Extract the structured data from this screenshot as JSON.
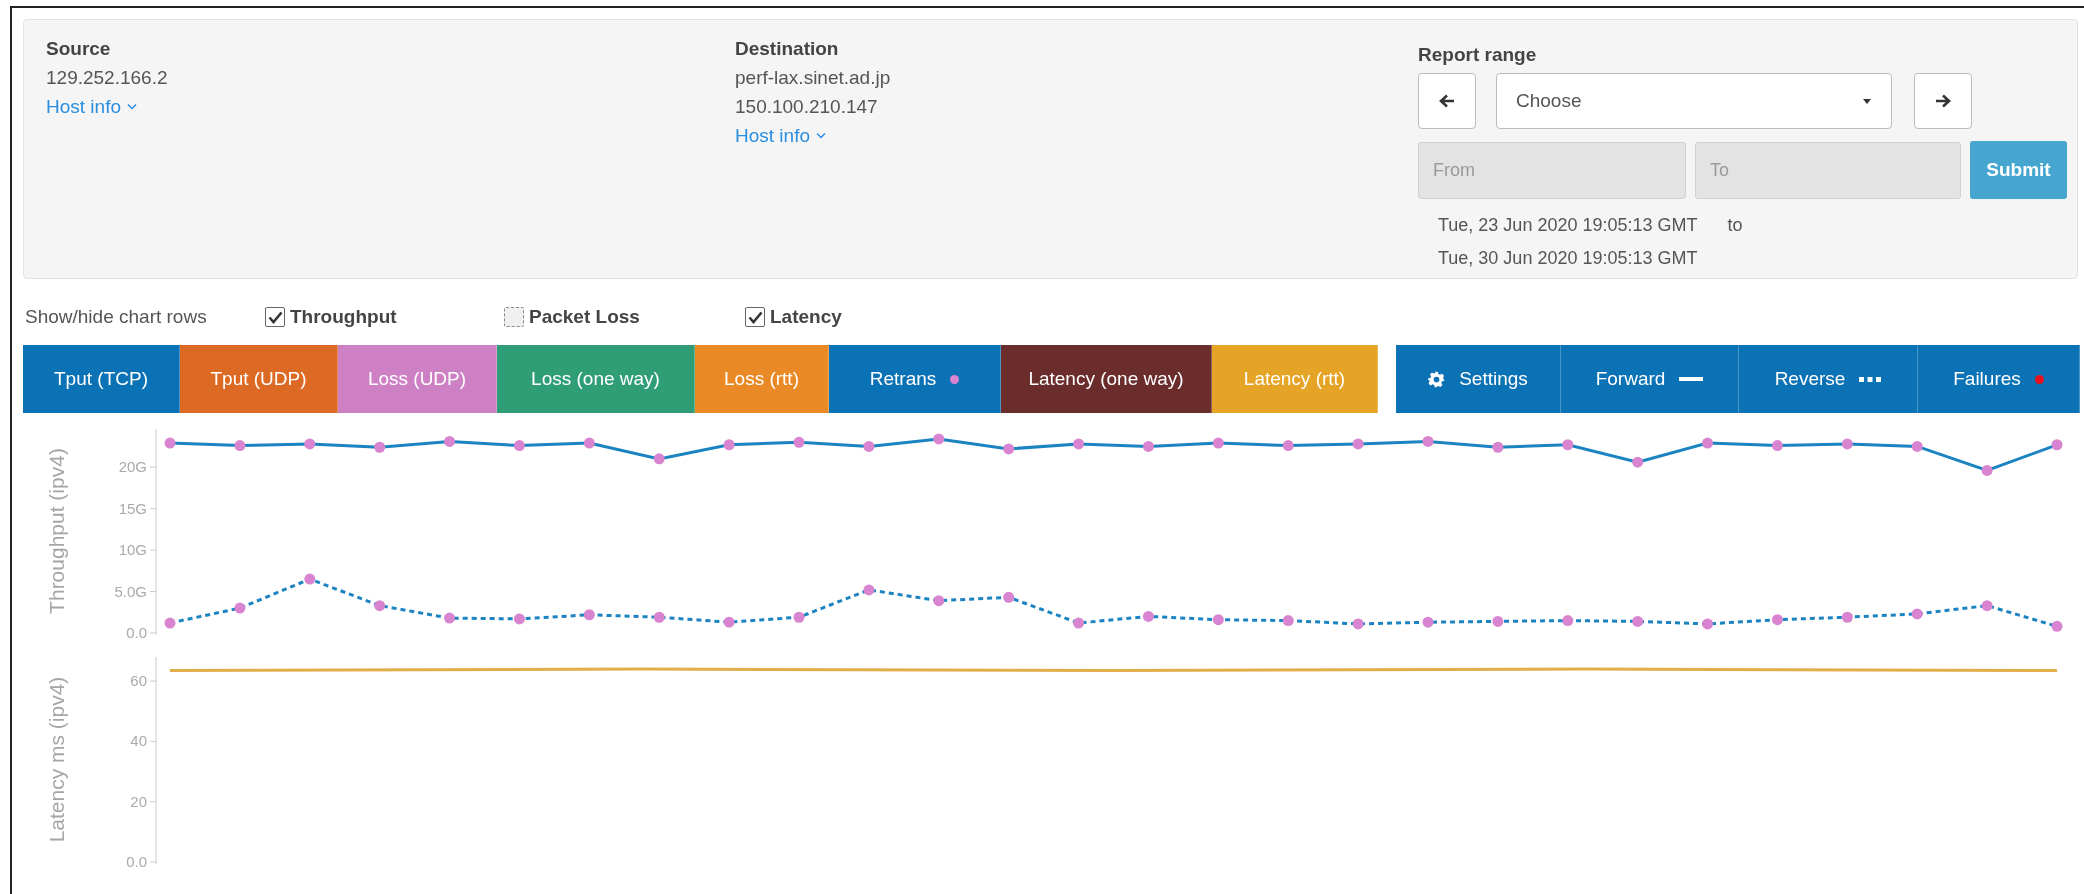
{
  "source": {
    "heading": "Source",
    "lines": [
      "129.252.166.2"
    ],
    "link": "Host info"
  },
  "destination": {
    "heading": "Destination",
    "lines": [
      "perf-lax.sinet.ad.jp",
      "150.100.210.147"
    ],
    "link": "Host info"
  },
  "report_range": {
    "heading": "Report range",
    "select": "Choose",
    "from_placeholder": "From",
    "to_placeholder": "To",
    "submit": "Submit",
    "start": "Tue, 23 Jun 2020 19:05:13 GMT",
    "joiner": "to",
    "end": "Tue, 30 Jun 2020 19:05:13 GMT"
  },
  "chart_rows": {
    "label": "Show/hide chart rows",
    "options": [
      {
        "label": "Throughput",
        "checked": true
      },
      {
        "label": "Packet Loss",
        "checked": false
      },
      {
        "label": "Latency",
        "checked": true
      }
    ]
  },
  "legend": [
    {
      "label": "Tput (TCP)",
      "color": "#0b72b5"
    },
    {
      "label": "Tput (UDP)",
      "color": "#dd6a24"
    },
    {
      "label": "Loss (UDP)",
      "color": "#cd80c4"
    },
    {
      "label": "Loss (one way)",
      "color": "#2f9e76"
    },
    {
      "label": "Loss (rtt)",
      "color": "#ea8a27"
    },
    {
      "label": "Retrans",
      "color": "#0b72b5",
      "marker": {
        "kind": "dot",
        "color": "#d884d0"
      }
    },
    {
      "label": "Latency (one way)",
      "color": "#6a2d2c"
    },
    {
      "label": "Latency (rtt)",
      "color": "#e5a425"
    }
  ],
  "controls": [
    {
      "label": "Settings",
      "marker": {
        "kind": "gear"
      }
    },
    {
      "label": "Forward",
      "marker": {
        "kind": "line"
      }
    },
    {
      "label": "Reverse",
      "marker": {
        "kind": "dots"
      }
    },
    {
      "label": "Failures",
      "marker": {
        "kind": "dot",
        "color": "#e8101a"
      }
    }
  ],
  "charts": [
    {
      "chart_data": {
        "type": "line",
        "ylabel": "Throughput (ipv4)",
        "ylim": [
          0,
          24.6
        ],
        "yticks": [
          {
            "value": 0,
            "label": "0.0"
          },
          {
            "value": 5,
            "label": "5.0G"
          },
          {
            "value": 10,
            "label": "10G"
          },
          {
            "value": 15,
            "label": "15G"
          },
          {
            "value": 20,
            "label": "20G"
          }
        ],
        "categories": [
          null,
          null,
          null,
          null,
          null,
          null,
          null,
          null,
          null,
          null,
          null,
          null,
          null,
          null,
          null,
          null,
          null,
          null,
          null,
          null,
          null,
          null,
          null,
          null,
          null,
          null,
          null,
          null
        ],
        "series": [
          {
            "color": "#1b83c0",
            "line_style": "solid",
            "marker": "circle",
            "values": [
              22.9,
              22.6,
              22.8,
              22.4,
              23.1,
              22.6,
              22.9,
              21.0,
              22.7,
              23.0,
              22.5,
              23.4,
              22.2,
              22.8,
              22.5,
              22.9,
              22.6,
              22.8,
              23.1,
              22.4,
              22.7,
              20.6,
              22.9,
              22.6,
              22.8,
              22.5,
              19.6,
              22.7
            ]
          },
          {
            "color": "#1b83c0",
            "line_style": "dotted",
            "marker": "circle",
            "values": [
              1.2,
              3.0,
              6.5,
              3.3,
              1.8,
              1.7,
              2.2,
              1.9,
              1.3,
              1.9,
              5.2,
              3.9,
              4.3,
              1.2,
              2.0,
              1.6,
              1.5,
              1.1,
              1.3,
              1.4,
              1.5,
              1.4,
              1.1,
              1.6,
              1.9,
              2.3,
              3.3,
              0.8
            ]
          }
        ]
      }
    },
    {
      "chart_data": {
        "type": "line",
        "ylabel": "Latency ms (ipv4)",
        "ylim": [
          0,
          68
        ],
        "yticks": [
          {
            "value": 0,
            "label": "0.0"
          },
          {
            "value": 20,
            "label": "20"
          },
          {
            "value": 40,
            "label": "40"
          },
          {
            "value": 60,
            "label": "60"
          }
        ],
        "categories": [
          null,
          null,
          null,
          null,
          null
        ],
        "series": [
          {
            "color": "#e0ae4a",
            "line_style": "solid",
            "values": [
              63.5,
              64,
              63.5,
              64,
              63.5
            ]
          }
        ]
      }
    }
  ]
}
